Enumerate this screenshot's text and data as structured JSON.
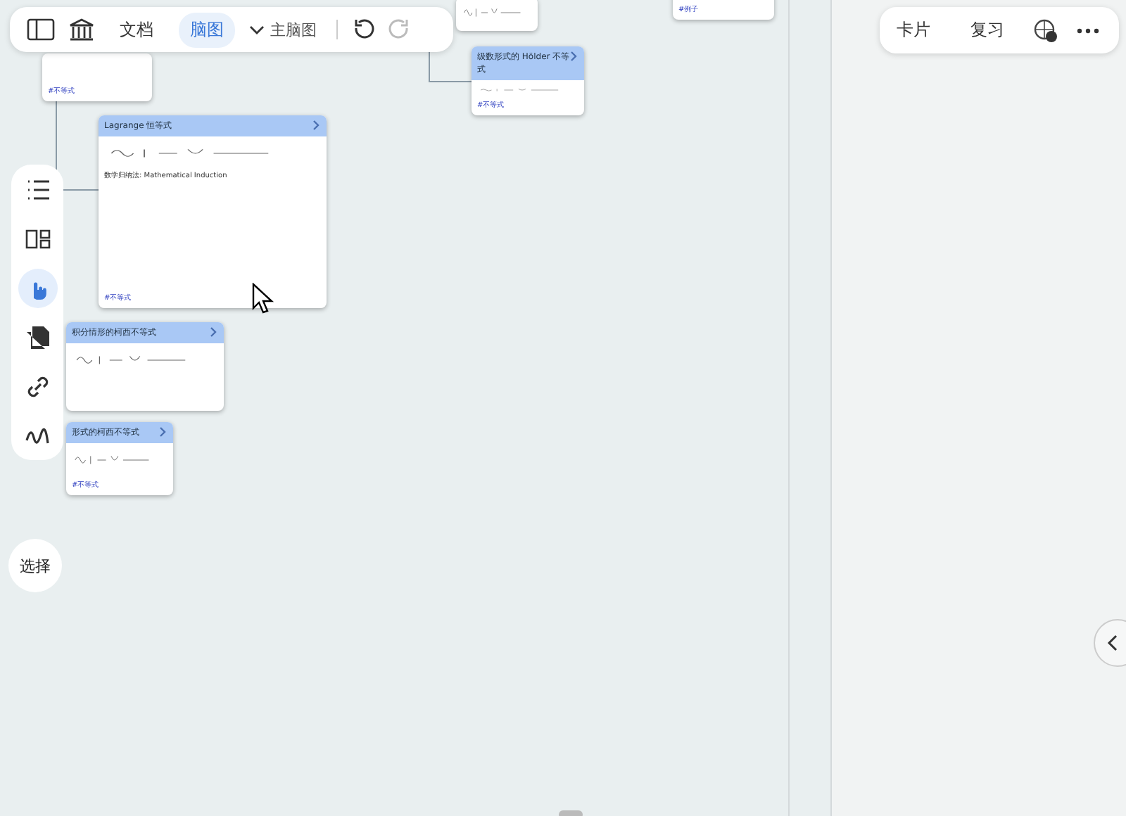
{
  "toolbar": {
    "items": [
      {
        "kind": "sidebar"
      },
      {
        "kind": "library"
      },
      {
        "kind": "text",
        "label": "文档",
        "selected": false
      },
      {
        "kind": "text",
        "label": "脑图",
        "selected": true
      },
      {
        "kind": "dropdown",
        "label": "主脑图"
      },
      {
        "kind": "undo"
      },
      {
        "kind": "redo"
      }
    ]
  },
  "right_toolbar": {
    "items": [
      {
        "kind": "text",
        "label": "卡片"
      },
      {
        "kind": "text",
        "label": "复习"
      },
      {
        "kind": "help"
      },
      {
        "kind": "more"
      }
    ]
  },
  "tools": [
    {
      "kind": "list",
      "selected": false
    },
    {
      "kind": "layout",
      "selected": false
    },
    {
      "kind": "hand",
      "selected": true
    },
    {
      "kind": "copy",
      "selected": false
    },
    {
      "kind": "link",
      "selected": false
    },
    {
      "kind": "curve",
      "selected": false
    }
  ],
  "select_button": "选择",
  "cards": [
    {
      "tag": "#不等式"
    },
    {
      "tag": "#例子"
    },
    {
      "title": "级数形式的 Hölder 不等式",
      "tag": "#不等式"
    },
    {
      "title": "Lagrange 恒等式",
      "tag": "#不等式",
      "lines": [
        "数学归纳法: Mathematical Induction"
      ]
    },
    {
      "title": "积分情形的柯西不等式"
    },
    {
      "title": "形式的柯西不等式",
      "tag": "#不等式"
    }
  ]
}
